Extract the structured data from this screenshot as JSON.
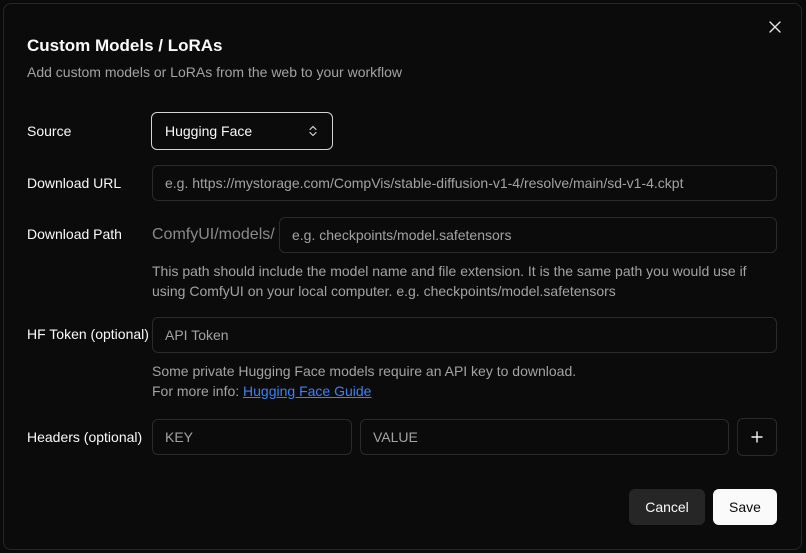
{
  "dialog": {
    "title": "Custom Models / LoRAs",
    "subtitle": "Add custom models or LoRAs from the web to your workflow",
    "close_icon": "close-icon"
  },
  "source": {
    "label": "Source",
    "selected": "Hugging Face",
    "icon": "chevron-up-down-icon"
  },
  "download_url": {
    "label": "Download URL",
    "value": "",
    "placeholder": "e.g. https://mystorage.com/CompVis/stable-diffusion-v1-4/resolve/main/sd-v1-4.ckpt"
  },
  "download_path": {
    "label": "Download Path",
    "prefix": "ComfyUI/models/",
    "value": "",
    "placeholder": "e.g. checkpoints/model.safetensors",
    "help": "This path should include the model name and file extension. It is the same path you would use if using ComfyUI on your local computer. e.g. checkpoints/model.safetensors"
  },
  "hf_token": {
    "label": "HF Token (optional)",
    "value": "",
    "placeholder": "API Token",
    "help_line1": "Some private Hugging Face models require an API key to download.",
    "help_line2_prefix": "For more info: ",
    "help_link": "Hugging Face Guide"
  },
  "headers": {
    "label": "Headers (optional)",
    "key_placeholder": "KEY",
    "value_placeholder": "VALUE",
    "add_icon": "plus-icon"
  },
  "actions": {
    "cancel_label": "Cancel",
    "save_label": "Save"
  },
  "colors": {
    "background": "#0b0b0b",
    "border": "#2a2a2a",
    "link": "#3b82f6",
    "primary_button": "#fafafa",
    "secondary_button": "#262626"
  }
}
